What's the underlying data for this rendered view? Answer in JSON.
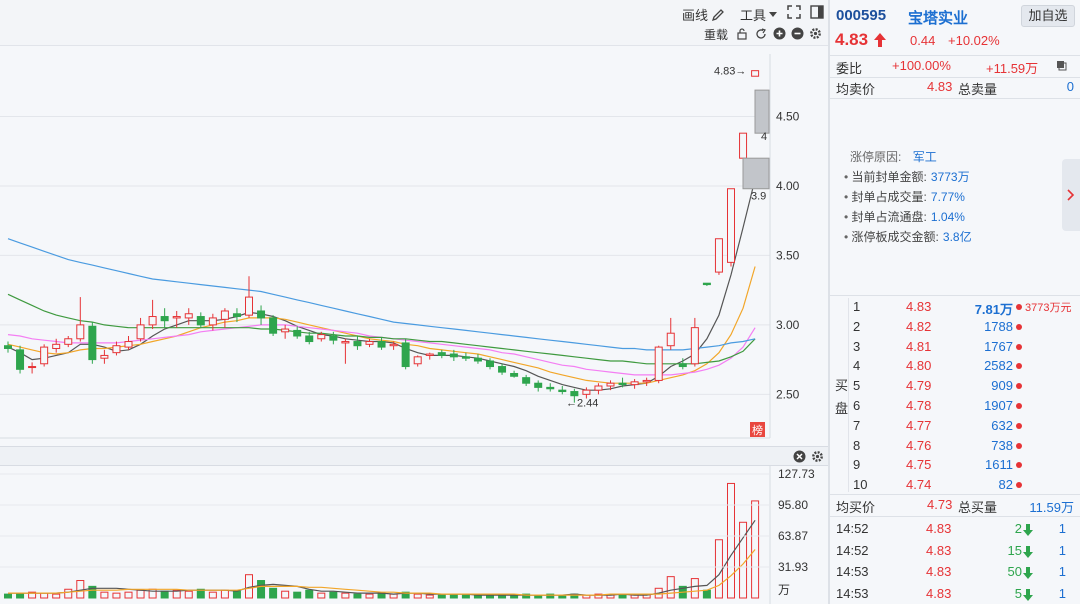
{
  "toolbar": {
    "draw_label": "画线",
    "tools_label": "工具",
    "reload_label": "重载"
  },
  "stock": {
    "code": "000595",
    "name": "宝塔实业",
    "add_watch": "加自选",
    "price": "4.83",
    "change": "0.44",
    "change_pct": "+10.02%"
  },
  "wei": {
    "label": "委比",
    "pct": "+100.00%",
    "diff": "+11.59万"
  },
  "avg_sell": {
    "label": "均卖价",
    "price": "4.83",
    "total_label": "总卖量",
    "total": "0"
  },
  "limit_info": {
    "reason_label": "涨停原因:",
    "reason": "军工",
    "items": [
      {
        "label": "当前封单金额:",
        "value": "3773万"
      },
      {
        "label": "封单占成交量:",
        "value": "7.77%"
      },
      {
        "label": "封单占流通盘:",
        "value": "1.04%"
      },
      {
        "label": "涨停板成交金额:",
        "value": "3.8亿"
      }
    ]
  },
  "buy_book": {
    "side_label_1": "买",
    "side_label_2": "盘",
    "rows": [
      {
        "level": "1",
        "price": "4.83",
        "volume": "7.81万",
        "extra": "3773万元"
      },
      {
        "level": "2",
        "price": "4.82",
        "volume": "1788",
        "extra": ""
      },
      {
        "level": "3",
        "price": "4.81",
        "volume": "1767",
        "extra": ""
      },
      {
        "level": "4",
        "price": "4.80",
        "volume": "2582",
        "extra": ""
      },
      {
        "level": "5",
        "price": "4.79",
        "volume": "909",
        "extra": ""
      },
      {
        "level": "6",
        "price": "4.78",
        "volume": "1907",
        "extra": ""
      },
      {
        "level": "7",
        "price": "4.77",
        "volume": "632",
        "extra": ""
      },
      {
        "level": "8",
        "price": "4.76",
        "volume": "738",
        "extra": ""
      },
      {
        "level": "9",
        "price": "4.75",
        "volume": "1611",
        "extra": ""
      },
      {
        "level": "10",
        "price": "4.74",
        "volume": "82",
        "extra": ""
      }
    ]
  },
  "avg_buy": {
    "label": "均买价",
    "price": "4.73",
    "total_label": "总买量",
    "total": "11.59万"
  },
  "ticks": [
    {
      "time": "14:52",
      "price": "4.83",
      "vol": "2",
      "num": "1"
    },
    {
      "time": "14:52",
      "price": "4.83",
      "vol": "15",
      "num": "1"
    },
    {
      "time": "14:53",
      "price": "4.83",
      "vol": "50",
      "num": "1"
    },
    {
      "time": "14:53",
      "price": "4.83",
      "vol": "5",
      "num": "1"
    }
  ],
  "chart_data": {
    "type": "candlestick",
    "price_axis": {
      "ticks": [
        "4.50",
        "4.00",
        "3.50",
        "3.00",
        "2.50"
      ],
      "range": [
        2.2,
        4.95
      ]
    },
    "annotations": {
      "high": "4.83→",
      "low": "←2.44",
      "gap_upper": "4",
      "gap_lower": "3.9",
      "limit_badge": "榜"
    },
    "volume_axis": {
      "ticks": [
        "127.73",
        "95.80",
        "63.87",
        "31.93"
      ],
      "unit": "万",
      "range": [
        0,
        127.73
      ]
    },
    "candles": [
      [
        2.85,
        2.88,
        2.8,
        2.83
      ],
      [
        2.82,
        2.85,
        2.65,
        2.68
      ],
      [
        2.7,
        2.73,
        2.65,
        2.7
      ],
      [
        2.72,
        2.86,
        2.7,
        2.84
      ],
      [
        2.83,
        2.9,
        2.8,
        2.86
      ],
      [
        2.86,
        2.92,
        2.84,
        2.9
      ],
      [
        2.9,
        3.2,
        2.88,
        3.0
      ],
      [
        2.99,
        3.02,
        2.72,
        2.75
      ],
      [
        2.76,
        2.82,
        2.72,
        2.78
      ],
      [
        2.8,
        2.88,
        2.78,
        2.85
      ],
      [
        2.84,
        2.92,
        2.82,
        2.88
      ],
      [
        2.9,
        3.05,
        2.88,
        3.0
      ],
      [
        3.0,
        3.18,
        2.97,
        3.06
      ],
      [
        3.06,
        3.12,
        2.98,
        3.03
      ],
      [
        3.05,
        3.1,
        2.98,
        3.06
      ],
      [
        3.05,
        3.12,
        3.0,
        3.08
      ],
      [
        3.06,
        3.09,
        2.98,
        3.0
      ],
      [
        3.0,
        3.08,
        2.96,
        3.05
      ],
      [
        3.04,
        3.12,
        2.98,
        3.1
      ],
      [
        3.08,
        3.12,
        3.02,
        3.06
      ],
      [
        3.07,
        3.35,
        3.05,
        3.2
      ],
      [
        3.1,
        3.14,
        3.0,
        3.05
      ],
      [
        3.05,
        3.07,
        2.92,
        2.94
      ],
      [
        2.95,
        3.0,
        2.9,
        2.97
      ],
      [
        2.96,
        2.99,
        2.9,
        2.92
      ],
      [
        2.92,
        2.95,
        2.86,
        2.88
      ],
      [
        2.9,
        2.95,
        2.88,
        2.93
      ],
      [
        2.92,
        2.95,
        2.86,
        2.89
      ],
      [
        2.87,
        2.9,
        2.72,
        2.88
      ],
      [
        2.88,
        2.92,
        2.82,
        2.85
      ],
      [
        2.86,
        2.9,
        2.84,
        2.88
      ],
      [
        2.88,
        2.91,
        2.82,
        2.84
      ],
      [
        2.85,
        2.88,
        2.82,
        2.86
      ],
      [
        2.87,
        2.9,
        2.68,
        2.7
      ],
      [
        2.72,
        2.78,
        2.7,
        2.77
      ],
      [
        2.78,
        2.8,
        2.75,
        2.79
      ],
      [
        2.8,
        2.82,
        2.76,
        2.78
      ],
      [
        2.79,
        2.82,
        2.74,
        2.77
      ],
      [
        2.77,
        2.8,
        2.74,
        2.76
      ],
      [
        2.76,
        2.79,
        2.72,
        2.74
      ],
      [
        2.74,
        2.76,
        2.68,
        2.7
      ],
      [
        2.7,
        2.72,
        2.64,
        2.66
      ],
      [
        2.65,
        2.67,
        2.62,
        2.63
      ],
      [
        2.62,
        2.64,
        2.56,
        2.58
      ],
      [
        2.58,
        2.6,
        2.52,
        2.55
      ],
      [
        2.55,
        2.58,
        2.52,
        2.54
      ],
      [
        2.53,
        2.56,
        2.5,
        2.52
      ],
      [
        2.52,
        2.54,
        2.44,
        2.49
      ],
      [
        2.5,
        2.55,
        2.47,
        2.53
      ],
      [
        2.53,
        2.58,
        2.5,
        2.56
      ],
      [
        2.56,
        2.6,
        2.53,
        2.58
      ],
      [
        2.58,
        2.62,
        2.55,
        2.57
      ],
      [
        2.57,
        2.61,
        2.54,
        2.59
      ],
      [
        2.59,
        2.62,
        2.56,
        2.6
      ],
      [
        2.6,
        2.85,
        2.58,
        2.84
      ],
      [
        2.85,
        3.05,
        2.82,
        2.94
      ],
      [
        2.72,
        2.76,
        2.68,
        2.7
      ],
      [
        2.72,
        3.05,
        2.7,
        2.98
      ],
      [
        3.3,
        3.3,
        3.28,
        3.29
      ],
      [
        3.38,
        3.62,
        3.36,
        3.62
      ],
      [
        3.45,
        3.98,
        3.42,
        3.98
      ],
      [
        4.2,
        4.38,
        4.2,
        4.38
      ],
      [
        4.79,
        4.83,
        4.79,
        4.83
      ]
    ],
    "volumes": [
      4,
      5,
      6,
      5,
      4,
      9,
      18,
      12,
      6,
      5,
      6,
      8,
      9,
      7,
      8,
      7,
      9,
      6,
      8,
      7,
      24,
      18,
      10,
      7,
      6,
      8,
      5,
      6,
      5,
      4,
      4,
      5,
      4,
      6,
      4,
      3,
      3,
      4,
      3,
      3,
      4,
      3,
      3,
      4,
      3,
      4,
      3,
      4,
      3,
      4,
      3,
      4,
      3,
      4,
      10,
      22,
      12,
      20,
      8,
      60,
      118,
      78,
      100
    ],
    "ma_price": [
      {
        "color": "#555555",
        "values": [
          2.84,
          2.8,
          2.75,
          2.76,
          2.78,
          2.8,
          2.86,
          2.86,
          2.84,
          2.81,
          2.82,
          2.86,
          2.92,
          2.97,
          3.0,
          3.03,
          3.03,
          3.03,
          3.04,
          3.06,
          3.09,
          3.08,
          3.06,
          3.03,
          2.99,
          2.96,
          2.93,
          2.92,
          2.9,
          2.89,
          2.88,
          2.88,
          2.87,
          2.83,
          2.8,
          2.78,
          2.78,
          2.78,
          2.77,
          2.76,
          2.74,
          2.72,
          2.7,
          2.67,
          2.63,
          2.6,
          2.57,
          2.55,
          2.53,
          2.53,
          2.54,
          2.56,
          2.57,
          2.58,
          2.63,
          2.7,
          2.74,
          2.79,
          2.9,
          3.07,
          3.36,
          3.7,
          4.05
        ]
      },
      {
        "color": "#f2a629",
        "values": [
          2.86,
          2.84,
          2.82,
          2.8,
          2.79,
          2.8,
          2.82,
          2.83,
          2.83,
          2.84,
          2.85,
          2.86,
          2.88,
          2.9,
          2.92,
          2.95,
          2.98,
          3.0,
          3.02,
          3.03,
          3.05,
          3.05,
          3.05,
          3.04,
          3.02,
          3.0,
          2.98,
          2.96,
          2.94,
          2.92,
          2.9,
          2.89,
          2.88,
          2.86,
          2.85,
          2.83,
          2.82,
          2.81,
          2.8,
          2.79,
          2.77,
          2.75,
          2.73,
          2.71,
          2.69,
          2.66,
          2.64,
          2.62,
          2.6,
          2.59,
          2.58,
          2.58,
          2.58,
          2.58,
          2.6,
          2.62,
          2.64,
          2.67,
          2.72,
          2.8,
          2.93,
          3.12,
          3.42
        ]
      },
      {
        "color": "#f47ef3",
        "values": [
          2.93,
          2.92,
          2.9,
          2.89,
          2.88,
          2.87,
          2.87,
          2.87,
          2.87,
          2.87,
          2.88,
          2.89,
          2.9,
          2.91,
          2.92,
          2.93,
          2.95,
          2.96,
          2.97,
          2.98,
          2.99,
          3.0,
          3.0,
          3.0,
          2.99,
          2.98,
          2.97,
          2.96,
          2.95,
          2.94,
          2.92,
          2.91,
          2.9,
          2.89,
          2.88,
          2.87,
          2.86,
          2.85,
          2.84,
          2.83,
          2.82,
          2.8,
          2.79,
          2.77,
          2.75,
          2.73,
          2.71,
          2.7,
          2.68,
          2.67,
          2.66,
          2.65,
          2.64,
          2.64,
          2.64,
          2.64,
          2.65,
          2.66,
          2.68,
          2.71,
          2.76,
          2.84,
          2.98
        ]
      },
      {
        "color": "#3f9a3f",
        "values": [
          3.22,
          3.18,
          3.14,
          3.1,
          3.07,
          3.05,
          3.03,
          3.02,
          3.0,
          2.99,
          2.98,
          2.98,
          2.98,
          2.98,
          2.98,
          2.98,
          2.98,
          2.98,
          2.98,
          2.98,
          2.98,
          2.97,
          2.97,
          2.96,
          2.95,
          2.94,
          2.94,
          2.93,
          2.92,
          2.92,
          2.91,
          2.91,
          2.9,
          2.9,
          2.89,
          2.88,
          2.88,
          2.87,
          2.86,
          2.85,
          2.84,
          2.83,
          2.82,
          2.81,
          2.8,
          2.79,
          2.78,
          2.77,
          2.76,
          2.75,
          2.74,
          2.74,
          2.73,
          2.72,
          2.72,
          2.72,
          2.72,
          2.72,
          2.73,
          2.74,
          2.77,
          2.81,
          2.9
        ]
      },
      {
        "color": "#4a9be0",
        "values": [
          3.62,
          3.59,
          3.56,
          3.53,
          3.5,
          3.47,
          3.45,
          3.43,
          3.41,
          3.39,
          3.37,
          3.35,
          3.33,
          3.32,
          3.31,
          3.3,
          3.29,
          3.28,
          3.27,
          3.26,
          3.25,
          3.24,
          3.22,
          3.2,
          3.18,
          3.16,
          3.14,
          3.12,
          3.1,
          3.08,
          3.06,
          3.04,
          3.02,
          3.01,
          3.0,
          2.99,
          2.98,
          2.97,
          2.96,
          2.95,
          2.94,
          2.93,
          2.92,
          2.91,
          2.9,
          2.89,
          2.88,
          2.87,
          2.86,
          2.85,
          2.84,
          2.83,
          2.83,
          2.82,
          2.82,
          2.82,
          2.82,
          2.83,
          2.84,
          2.85,
          2.87,
          2.88,
          2.9
        ]
      }
    ],
    "ma_volume": [
      {
        "color": "#555555",
        "values": [
          5,
          5,
          5,
          5,
          5,
          6,
          8,
          10,
          10,
          10,
          9,
          8,
          7,
          7,
          7,
          8,
          8,
          8,
          8,
          7,
          11,
          13,
          14,
          13,
          12,
          9,
          7,
          7,
          6,
          5,
          5,
          5,
          4,
          5,
          5,
          4,
          4,
          4,
          4,
          3,
          3,
          3,
          3,
          3,
          3,
          3,
          3,
          4,
          3,
          3,
          3,
          4,
          3,
          3,
          5,
          8,
          10,
          12,
          13,
          24,
          44,
          62,
          80
        ]
      },
      {
        "color": "#f2a629",
        "values": [
          5,
          5,
          5,
          5,
          5,
          6,
          7,
          8,
          8,
          8,
          9,
          9,
          9,
          9,
          9,
          8,
          8,
          8,
          8,
          8,
          10,
          12,
          12,
          12,
          12,
          11,
          11,
          10,
          9,
          8,
          7,
          6,
          6,
          5,
          5,
          5,
          4,
          4,
          4,
          4,
          4,
          4,
          4,
          3,
          3,
          3,
          3,
          3,
          3,
          3,
          4,
          4,
          4,
          4,
          4,
          5,
          6,
          7,
          8,
          13,
          23,
          35,
          50
        ]
      }
    ]
  }
}
